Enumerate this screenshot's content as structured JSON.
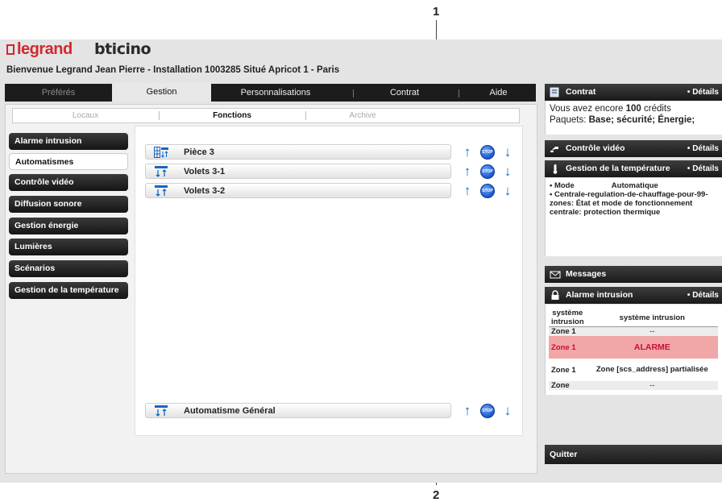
{
  "callouts": {
    "top": "1",
    "bottom": "2"
  },
  "header": {
    "logo_legrand": "legrand",
    "logo_bticino": "bticino",
    "welcome": "Bienvenue Legrand Jean Pierre - Installation 1003285 Situé Apricot 1 - Paris"
  },
  "tabs": [
    {
      "label": "Préférés",
      "state": "disabled"
    },
    {
      "label": "Gestion",
      "state": "active"
    },
    {
      "label": "Personnalisations",
      "state": "normal"
    },
    {
      "label": "Contrat",
      "state": "normal"
    },
    {
      "label": "Aide",
      "state": "normal"
    }
  ],
  "subtabs": [
    {
      "label": "Locaux",
      "active": false
    },
    {
      "label": "Fonctions",
      "active": true
    },
    {
      "label": "Archive",
      "active": false
    }
  ],
  "sidebar": {
    "items": [
      {
        "label": "Alarme intrusion",
        "active": false
      },
      {
        "label": "Automatismes",
        "active": true
      },
      {
        "label": "Contrôle vidéo",
        "active": false
      },
      {
        "label": "Diffusion sonore",
        "active": false
      },
      {
        "label": "Gestion énergie",
        "active": false
      },
      {
        "label": "Lumières",
        "active": false
      },
      {
        "label": "Scénarios",
        "active": false
      },
      {
        "label": "Gestion de la température",
        "active": false
      }
    ]
  },
  "functions": {
    "rows": [
      {
        "label": "Pièce 3",
        "icon": "room-shutter-icon"
      },
      {
        "label": "Volets 3-1",
        "icon": "shutter-icon"
      },
      {
        "label": "Volets 3-2",
        "icon": "shutter-icon"
      }
    ],
    "general": {
      "label": "Automatisme Général",
      "icon": "shutter-icon"
    },
    "stop_text": "STOP"
  },
  "right": {
    "contrat": {
      "title": "Contrat",
      "details": "• Détails",
      "line1_pre": "Vous avez encore ",
      "credits": "100",
      "line1_post": " crédits",
      "line2_pre": "Paquets: ",
      "packages": "Base; sécurité; Énergie;"
    },
    "video": {
      "title": "Contrôle vidéo",
      "details": "• Détails"
    },
    "temperature": {
      "title": "Gestion de la température",
      "details": "• Détails",
      "mode_label": "• Mode",
      "mode_value": "Automatique",
      "text": "• Centrale-regulation-de-chauffage-pour-99-zones: État et mode de fonctionnement centrale: protection thermique"
    },
    "messages": {
      "title": "Messages"
    },
    "alarm": {
      "title": "Alarme intrusion",
      "details": "• Détails",
      "headers": [
        "système intrusion",
        "système intrusion"
      ],
      "rows": [
        {
          "zone": "Zone 1",
          "status": "--",
          "alarm": false
        },
        {
          "zone": "Zone 1",
          "status": "ALARME",
          "alarm": true
        },
        {
          "zone": "Zone 1",
          "status": "Zone [scs_address] partialisée",
          "alarm": false
        },
        {
          "zone": "Zone",
          "status": "--",
          "alarm": false
        }
      ]
    },
    "quit": "Quitter"
  },
  "colors": {
    "accent": "#1766c4",
    "alarm_bg": "#f1a7a7",
    "alarm_text": "#c8102e",
    "logo_red": "#d1282e"
  }
}
